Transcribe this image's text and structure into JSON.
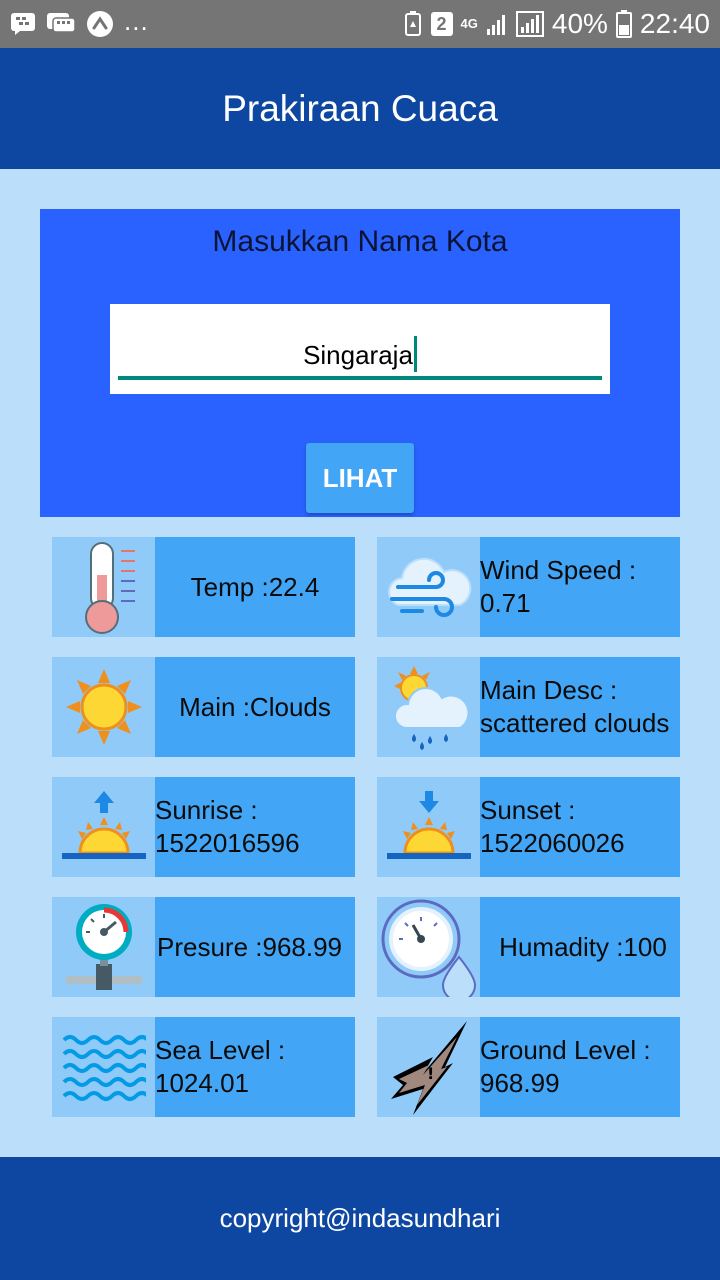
{
  "status_bar": {
    "sim_badge": "2",
    "network": "4G",
    "battery_percent": "40%",
    "time": "22:40",
    "overflow": "..."
  },
  "app": {
    "title": "Prakiraan Cuaca"
  },
  "search": {
    "title": "Masukkan Nama Kota",
    "city_value": "Singaraja",
    "button_label": "LIHAT"
  },
  "cards": {
    "temp": {
      "text": "Temp :22.4",
      "icon": "thermometer-icon"
    },
    "wind": {
      "text": "Wind Speed : 0.71",
      "icon": "wind-cloud-icon"
    },
    "main": {
      "text": "Main :Clouds",
      "icon": "sun-icon"
    },
    "desc": {
      "text": "Main Desc : scattered clouds",
      "icon": "sun-rain-cloud-icon"
    },
    "sunrise": {
      "text": "Sunrise : 1522016596",
      "icon": "sunrise-icon"
    },
    "sunset": {
      "text": "Sunset : 1522060026",
      "icon": "sunset-icon"
    },
    "pressure": {
      "text": "Presure :968.99",
      "icon": "pressure-gauge-icon"
    },
    "humidity": {
      "text": "Humadity :100",
      "icon": "humidity-gauge-icon"
    },
    "sea": {
      "text": "Sea Level : 1024.01",
      "icon": "waves-icon"
    },
    "ground": {
      "text": "Ground Level : 968.99",
      "icon": "earthquake-icon"
    }
  },
  "footer": {
    "text": "copyright@indasundhari"
  },
  "colors": {
    "app_bar": "#0d47a1",
    "panel": "#2962ff",
    "background": "#bbdefb",
    "card_text_bg": "#42a5f5",
    "card_icon_bg": "#90caf9",
    "accent": "#00897b"
  }
}
